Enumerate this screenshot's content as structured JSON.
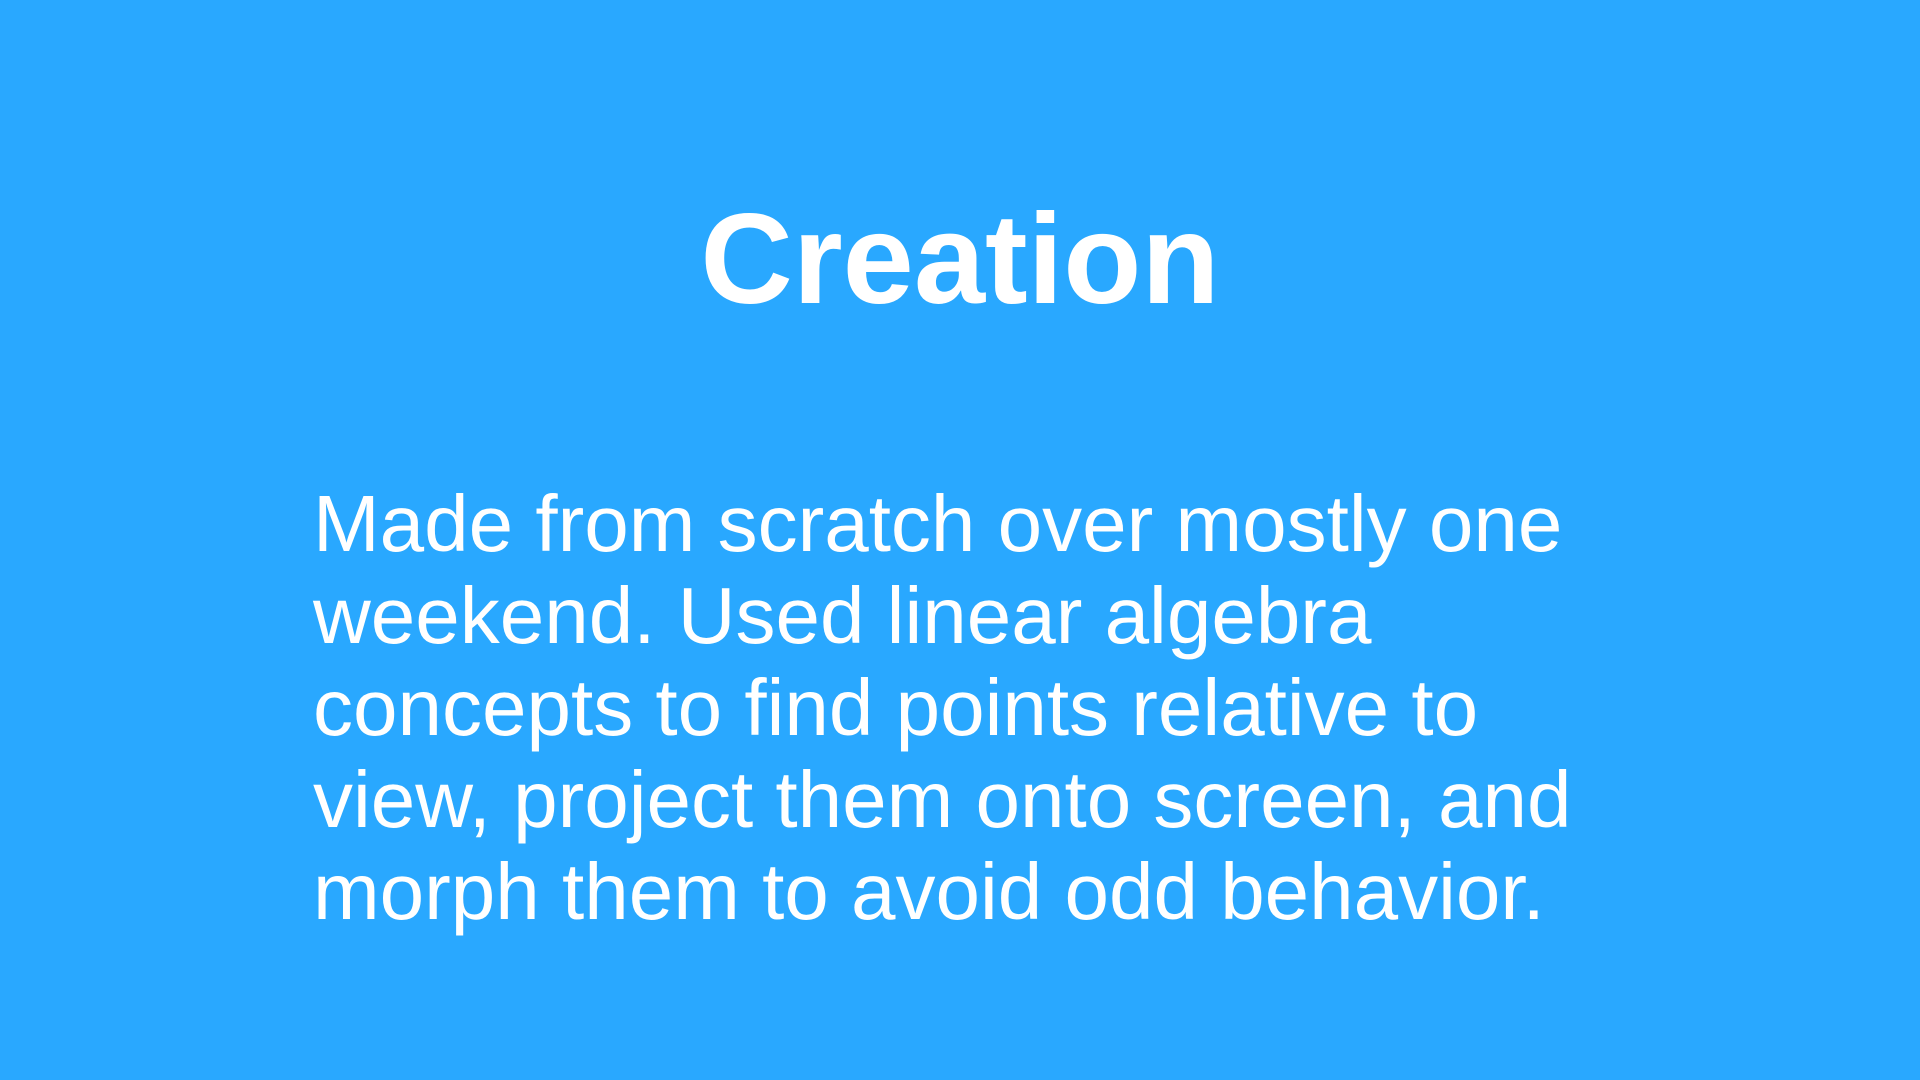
{
  "slide": {
    "title": "Creation",
    "body_lines": [
      "Made from scratch over mostly one",
      "weekend. Used linear algebra",
      "concepts to find points relative to",
      "view, project them onto screen, and",
      "morph them to avoid odd behavior."
    ],
    "background_color": "#29A8FF"
  }
}
